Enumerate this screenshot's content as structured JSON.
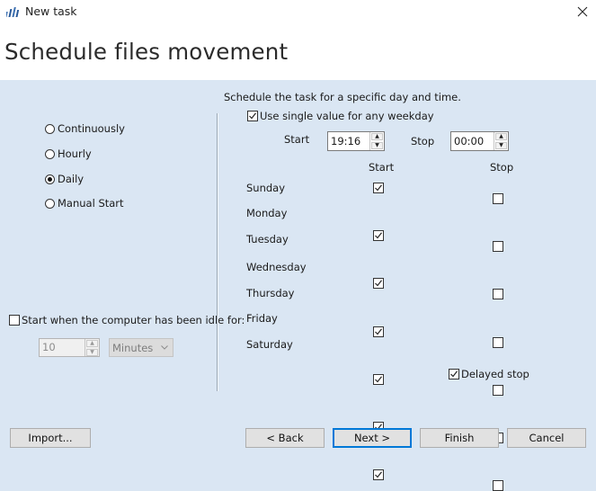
{
  "window": {
    "title": "New task",
    "close_glyph": "✕",
    "logo_icon": "app-logo-icon"
  },
  "header": {
    "title": "Schedule files movement"
  },
  "schedule_mode": {
    "options": [
      {
        "label": "Continuously",
        "checked": false
      },
      {
        "label": "Hourly",
        "checked": false
      },
      {
        "label": "Daily",
        "checked": true
      },
      {
        "label": "Manual Start",
        "checked": false
      }
    ]
  },
  "idle": {
    "label": "Start when the computer has been idle for:",
    "checked": false,
    "value": "10",
    "unit": "Minutes"
  },
  "daily": {
    "description": "Schedule the task for a specific day and time.",
    "single_value_label": "Use single value for any weekday",
    "single_value_checked": true,
    "start_label": "Start",
    "start_time": "19:16",
    "stop_label": "Stop",
    "stop_time": "00:00",
    "col_start": "Start",
    "col_stop": "Stop",
    "days": [
      {
        "name": "Sunday",
        "start": true,
        "stop": false
      },
      {
        "name": "Monday",
        "start": true,
        "stop": false
      },
      {
        "name": "Tuesday",
        "start": true,
        "stop": false
      },
      {
        "name": "Wednesday",
        "start": true,
        "stop": false
      },
      {
        "name": "Thursday",
        "start": true,
        "stop": false
      },
      {
        "name": "Friday",
        "start": true,
        "stop": false
      },
      {
        "name": "Saturday",
        "start": true,
        "stop": false
      }
    ],
    "delayed_stop_label": "Delayed stop",
    "delayed_stop_checked": true
  },
  "buttons": {
    "import": "Import...",
    "back": "< Back",
    "next": "Next >",
    "finish": "Finish",
    "cancel": "Cancel"
  },
  "colors": {
    "background": "#dae6f3",
    "header": "#ffffff",
    "default_button_border": "#0078d7"
  }
}
